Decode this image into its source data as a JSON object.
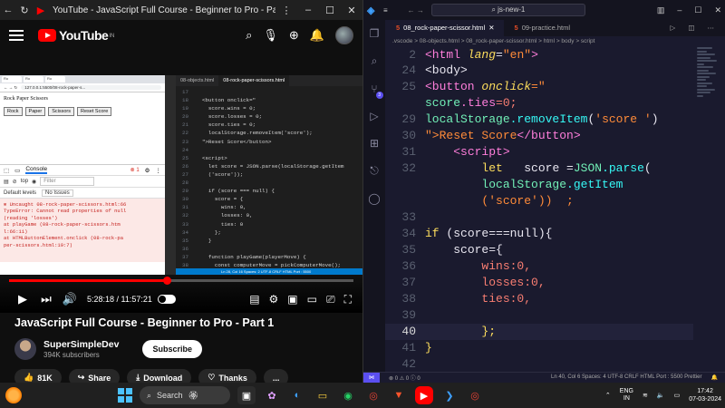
{
  "youtube": {
    "window_title": "YouTube - JavaScript Full Course - Beginner to Pro - Part 1 - ...",
    "logo_text": "YouTube",
    "logo_suffix": "IN",
    "video": {
      "time_current": "5:28:18",
      "time_total": "11:57:21",
      "time_sep": " / ",
      "progress": 0.458
    },
    "title": "JavaScript Full Course - Beginner to Pro - Part 1",
    "channel_name": "SuperSimpleDev",
    "subscribers": "394K subscribers",
    "subscribe_label": "Subscribe",
    "like_count": "81K",
    "share_label": "Share",
    "download_label": "Download",
    "thanks_label": "Thanks",
    "more_label": "..."
  },
  "inner_browser": {
    "url": "127.0.0.1:5500/08-rock-paper-s...",
    "heading": "Rock Paper Scissors",
    "buttons": [
      "Rock",
      "Paper",
      "Scissors",
      "Reset Score"
    ],
    "devtools_console_tab": "Console",
    "error_count": "1",
    "context": "top",
    "filter_placeholder": "Filter",
    "levels": "Default levels",
    "issues": "No Issues",
    "error_lines": [
      "Uncaught    08-rock-paper-scissors.html:66",
      "TypeError: Cannot read properties of null",
      "(reading 'losses')",
      "    at playGame (08-rock-paper-scissors.htm",
      "l:66:11)",
      "    at HTMLButtonElement.onclick (08-rock-pa",
      "per-scissors.html:19:7)"
    ]
  },
  "inner_code": {
    "tabs": [
      "08-objects.html",
      "08-rock-paper-scissors.html"
    ],
    "lines": [
      {
        "n": "17",
        "t": ""
      },
      {
        "n": "18",
        "t": "  <button onclick=\""
      },
      {
        "n": "19",
        "t": "    score.wins = 0;"
      },
      {
        "n": "20",
        "t": "    score.losses = 0;"
      },
      {
        "n": "21",
        "t": "    score.ties = 0;"
      },
      {
        "n": "22",
        "t": "    localStorage.removeItem('score');"
      },
      {
        "n": "23",
        "t": "  \">Reset Score</button>"
      },
      {
        "n": "24",
        "t": ""
      },
      {
        "n": "25",
        "t": "  <script>"
      },
      {
        "n": "26",
        "t": "    let score = JSON.parse(localStorage.getItem"
      },
      {
        "n": "27",
        "t": "    ('score'));"
      },
      {
        "n": "28",
        "t": ""
      },
      {
        "n": "29",
        "t": "    if (score === null) {"
      },
      {
        "n": "30",
        "t": "      score = {"
      },
      {
        "n": "31",
        "t": "        wins: 0,"
      },
      {
        "n": "32",
        "t": "        losses: 0,"
      },
      {
        "n": "33",
        "t": "        ties: 0"
      },
      {
        "n": "34",
        "t": "      };"
      },
      {
        "n": "35",
        "t": "    }"
      },
      {
        "n": "36",
        "t": ""
      },
      {
        "n": "37",
        "t": "    function playGame(playerMove) {"
      },
      {
        "n": "38",
        "t": "      const computerMove = pickComputerMove();"
      }
    ],
    "status": "Ln 28, Col 16   Spaces: 2   UTF-8   CRLF   HTML   Port : 5500"
  },
  "vscode": {
    "search": "js-new-1",
    "tabs": [
      {
        "label": "08_rock-paper-scissor.html",
        "active": true
      },
      {
        "label": "09-practice.html",
        "active": false
      }
    ],
    "breadcrumb": ".vscode > 08-objects.html > 08_rock-paper-scissor.html > html > body > script",
    "lines": [
      {
        "n": "2"
      },
      {
        "n": "24"
      },
      {
        "n": "25"
      },
      {
        "n": ""
      },
      {
        "n": "29"
      },
      {
        "n": "30"
      },
      {
        "n": "31"
      },
      {
        "n": "32"
      },
      {
        "n": ""
      },
      {
        "n": ""
      },
      {
        "n": "33"
      },
      {
        "n": "34"
      },
      {
        "n": "35"
      },
      {
        "n": "36"
      },
      {
        "n": "37"
      },
      {
        "n": "38"
      },
      {
        "n": "39"
      },
      {
        "n": "40"
      },
      {
        "n": "41"
      },
      {
        "n": "42"
      }
    ],
    "code": {
      "l2_tag": "<html",
      "l2_attr": " lang",
      "l2_eq": "=",
      "l2_str": "\"en\"",
      "l2_end": ">",
      "l24": "<body>",
      "l25_tag": "<button",
      "l25_attr": " onclick",
      "l25_eq": "=\"",
      "l26_obj": "score",
      "l26_prop": ".ties",
      "l26_rest": "=0;",
      "l29_obj": "localStorage",
      "l29_fn": ".removeItem",
      "l29_p1": "(",
      "l29_str": "'score '",
      "l29_p2": ")",
      "l30_a": "\">Reset Score",
      "l30_tag": "</button>",
      "l31": "<script>",
      "l32_kw": "let",
      "l32_var": "score",
      "l32_eq": " =",
      "l32_obj": "JSON",
      "l32_fn": ".parse",
      "l32_p": "(",
      "l32b_obj": "localStorage",
      "l32b_fn": ".getItem",
      "l32c": "('score'))  ;",
      "l34_kw": "if",
      "l34_rest": " (score===null){",
      "l35": "score={",
      "l36": "wins:0,",
      "l37": "losses:0,",
      "l38": "ties:0,",
      "l40": "};",
      "l41": "}"
    },
    "status_left": "Ln 40, Col 6   Spaces: 4   UTF-8   CRLF   HTML   Port : 5500   Prettier",
    "status_errors": "⊗ 0 ⚠ 0  ⓘ 0"
  },
  "taskbar": {
    "search_label": "Search",
    "lang_top": "ENG",
    "lang_bottom": "IN",
    "time": "17:42",
    "date": "07-03-2024"
  }
}
